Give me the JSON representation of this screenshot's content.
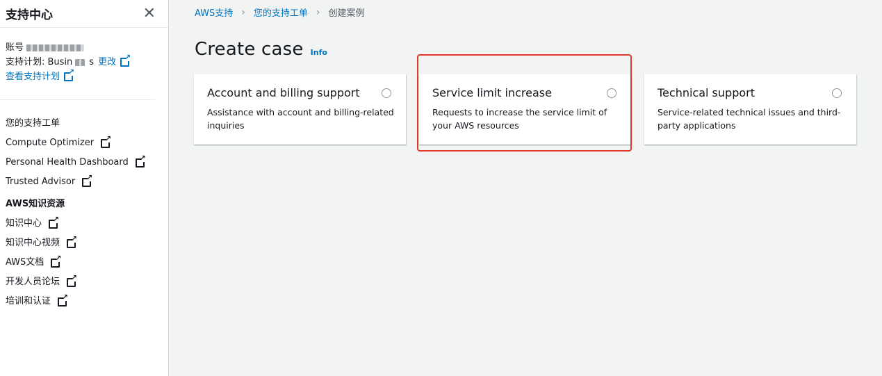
{
  "sidebar": {
    "title": "支持中心",
    "account_label": "账号",
    "plan_label": "支持计划: Busin",
    "plan_tail": "s",
    "change_link": "更改",
    "view_plans_link": "查看支持计划",
    "nav": [
      {
        "label": "您的支持工单",
        "external": false
      },
      {
        "label": "Compute Optimizer",
        "external": true
      },
      {
        "label": "Personal Health Dashboard",
        "external": true
      },
      {
        "label": "Trusted Advisor",
        "external": true
      }
    ],
    "knowledge_heading": "AWS知识资源",
    "knowledge": [
      {
        "label": "知识中心"
      },
      {
        "label": "知识中心视频"
      },
      {
        "label": "AWS文档"
      },
      {
        "label": "开发人员论坛"
      },
      {
        "label": "培训和认证"
      }
    ]
  },
  "breadcrumb": {
    "items": [
      "AWS支持",
      "您的支持工单",
      "创建案例"
    ]
  },
  "page": {
    "title": "Create case",
    "info": "Info"
  },
  "cards": [
    {
      "title": "Account and billing support",
      "desc": "Assistance with account and billing-related inquiries",
      "selected": false
    },
    {
      "title": "Service limit increase",
      "desc": "Requests to increase the service limit of your AWS resources",
      "selected": false
    },
    {
      "title": "Technical support",
      "desc": "Service-related technical issues and third-party applications",
      "selected": false
    }
  ],
  "colors": {
    "link": "#0073bb",
    "highlight": "#e2372b",
    "background": "#f2f3f3"
  }
}
